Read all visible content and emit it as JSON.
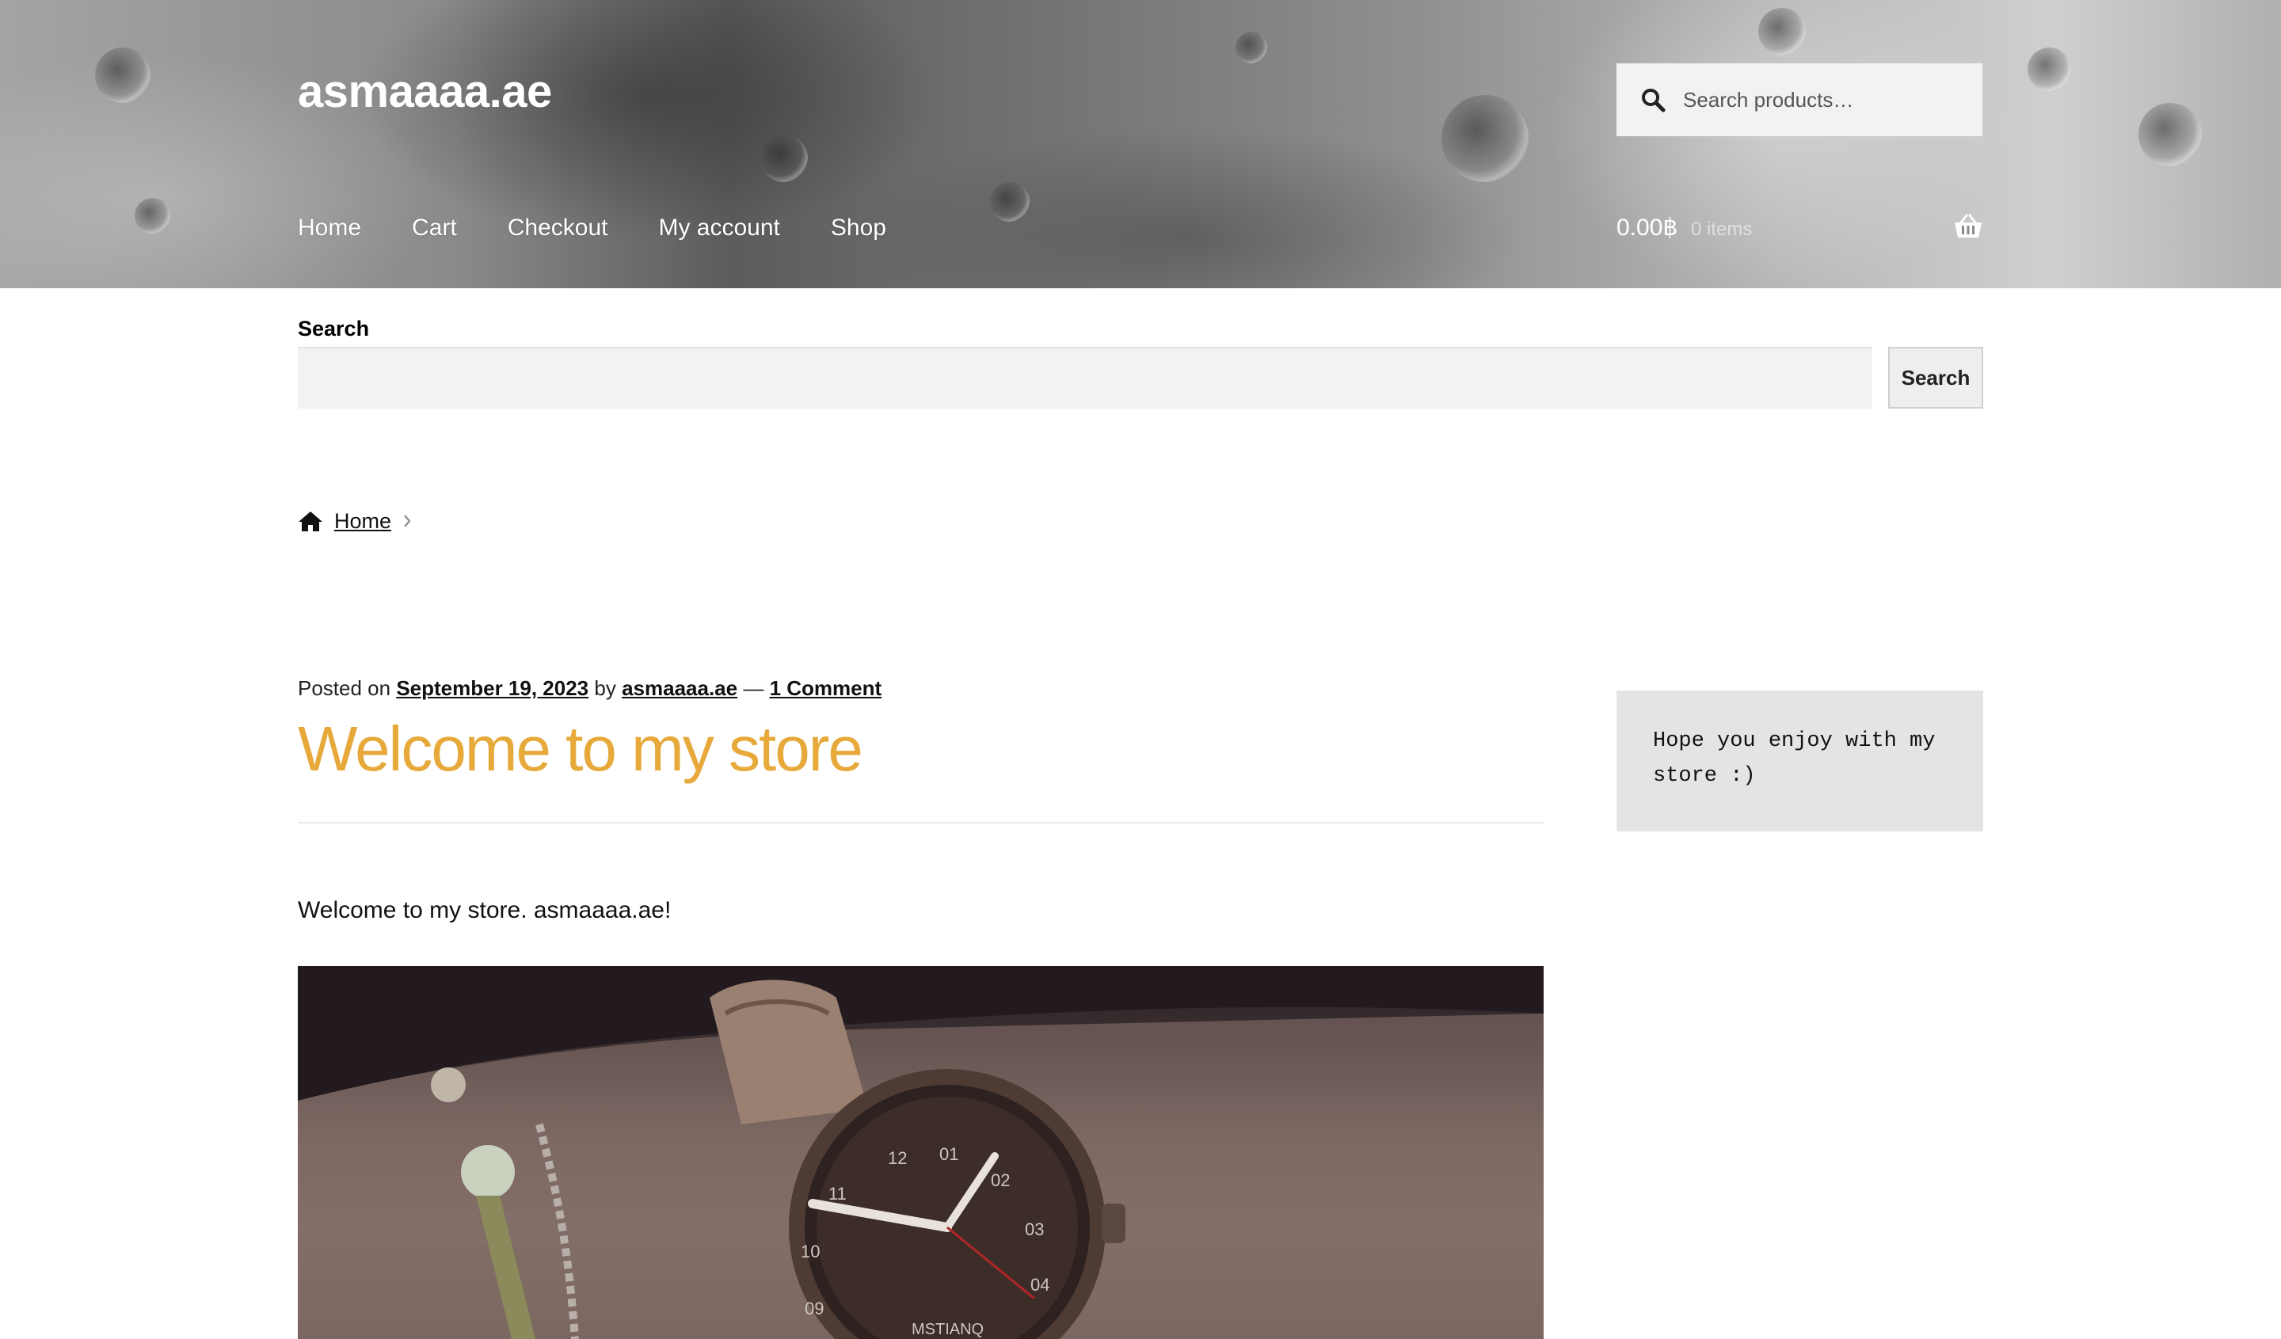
{
  "header": {
    "site_title": "asmaaaa.ae",
    "nav": [
      "Home",
      "Cart",
      "Checkout",
      "My account",
      "Shop"
    ],
    "search_placeholder": "Search products…",
    "cart_amount": "0.00฿",
    "cart_count": "0 items"
  },
  "search_widget": {
    "label": "Search",
    "value": "",
    "button_label": "Search"
  },
  "breadcrumb": {
    "home_label": "Home"
  },
  "post": {
    "posted_on_prefix": "Posted on",
    "date": "September 19, 2023",
    "by_prefix": "by",
    "author": "asmaaaa.ae",
    "separator": "—",
    "comments": "1 Comment",
    "title": "Welcome to my store",
    "body": "Welcome to my store. asmaaaa.ae!",
    "image_alt": "Watch photo",
    "watch_brand": "MSTIANQ",
    "dial_numbers": [
      "12",
      "01",
      "02",
      "03",
      "04",
      "11",
      "10",
      "09"
    ]
  },
  "sidebar": {
    "widget_text": "Hope you enjoy with my store :)"
  },
  "colors": {
    "title_accent": "#e6a93a",
    "widget_bg": "#e4e4e4"
  }
}
